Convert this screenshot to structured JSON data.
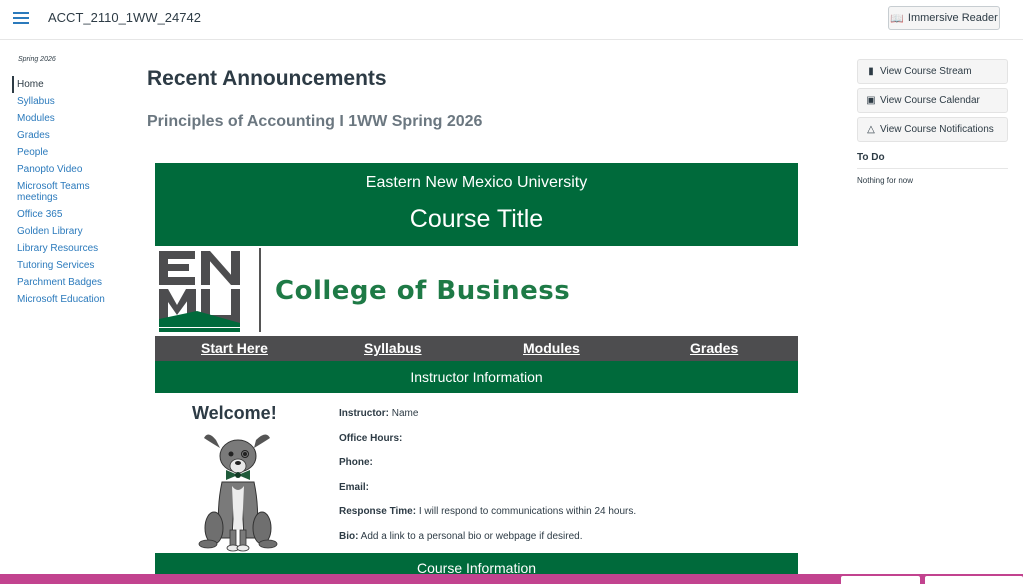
{
  "header": {
    "course_code": "ACCT_2110_1WW_24742",
    "immersive_reader_label": "Immersive Reader"
  },
  "sidebar": {
    "term": "Spring 2026",
    "items": [
      {
        "label": "Home"
      },
      {
        "label": "Syllabus"
      },
      {
        "label": "Modules"
      },
      {
        "label": "Grades"
      },
      {
        "label": "People"
      },
      {
        "label": "Panopto Video"
      },
      {
        "label": "Microsoft Teams meetings"
      },
      {
        "label": "Office 365"
      },
      {
        "label": "Golden Library"
      },
      {
        "label": "Library Resources"
      },
      {
        "label": "Tutoring Services"
      },
      {
        "label": "Parchment Badges"
      },
      {
        "label": "Microsoft Education"
      }
    ]
  },
  "main": {
    "heading": "Recent Announcements",
    "subheading": "Principles of Accounting I 1WW Spring 2026",
    "banner": {
      "university": "Eastern New Mexico University",
      "course_title": "Course Title"
    },
    "logo": {
      "enmu_text": "EN MU",
      "college": "College of Business"
    },
    "links": [
      "Start Here",
      "Syllabus",
      "Modules",
      "Grades"
    ],
    "instructor_bar": "Instructor Information",
    "welcome": "Welcome!",
    "info": [
      {
        "label": "Instructor:",
        "value": " Name"
      },
      {
        "label": "Office Hours:",
        "value": ""
      },
      {
        "label": "Phone:",
        "value": ""
      },
      {
        "label": "Email:",
        "value": ""
      },
      {
        "label": "Response Time:",
        "value": " I will respond to communications within 24 hours."
      },
      {
        "label": "Bio:",
        "value": " Add a link to a personal bio or webpage if desired."
      }
    ],
    "course_info_bar": "Course Information"
  },
  "right_sidebar": {
    "buttons": [
      {
        "label": "View Course Stream",
        "icon": "bar-chart-icon"
      },
      {
        "label": "View Course Calendar",
        "icon": "calendar-icon"
      },
      {
        "label": "View Course Notifications",
        "icon": "bell-icon"
      }
    ],
    "todo_heading": "To Do",
    "todo_empty": "Nothing for now"
  },
  "colors": {
    "enmu_green": "#006a3b",
    "link_bar_gray": "#4d4d4f",
    "link_blue": "#2b7abc",
    "bottom_banner": "#c2438f"
  }
}
